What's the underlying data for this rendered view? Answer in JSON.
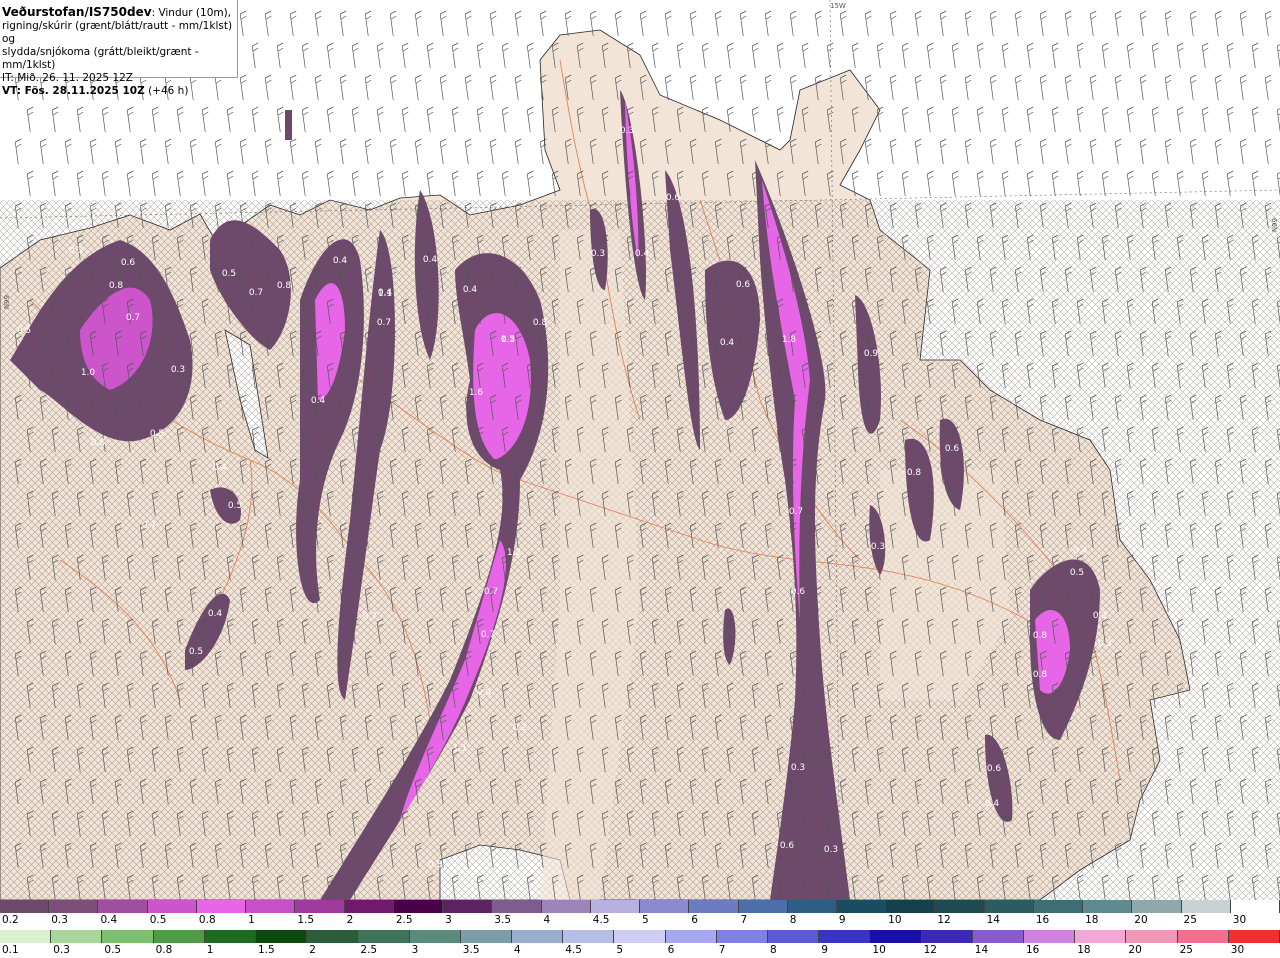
{
  "header": {
    "org": "Veðurstofan/IS750dev",
    "desc1": ": Vindur (10m),",
    "desc2": "rigning/skúrir (grænt/blátt/rautt - mm/1klst) og",
    "desc3": "slydda/snjókoma (grátt/bleikt/grænt - mm/1klst)",
    "it": "IT: Mið. 26. 11. 2025 12Z",
    "vt": "VT: Fös. 28.11.2025 10Z",
    "vt_offset": " (+46 h)"
  },
  "grid_labels": {
    "top": "15W",
    "right": "66N",
    "left": "66N"
  },
  "legend_snow": {
    "ticks": [
      "0.2",
      "0.3",
      "0.4",
      "0.5",
      "0.8",
      "1",
      "1.5",
      "2",
      "2.5",
      "3",
      "3.5",
      "4",
      "4.5",
      "5",
      "6",
      "7",
      "8",
      "9",
      "10",
      "12",
      "14",
      "16",
      "18",
      "20",
      "25",
      "30"
    ],
    "colors": [
      "#6d4a6b",
      "#7d4d7b",
      "#a24ea0",
      "#cc55cc",
      "#e766e7",
      "#c84fc8",
      "#a13a9e",
      "#6f1a6d",
      "#4a0048",
      "#5b2460",
      "#7e5c8e",
      "#9c86b7",
      "#b7b0e0",
      "#8a8ad0",
      "#6b7cc1",
      "#4d6fa9",
      "#2e5e86",
      "#1a4c62",
      "#17404e",
      "#1e4a52",
      "#2b5c62",
      "#3e6e74",
      "#5f8a90",
      "#8fa8ac",
      "#c8d2d4",
      "#ffffff"
    ]
  },
  "legend_rain": {
    "ticks": [
      "0.1",
      "0.3",
      "0.5",
      "0.8",
      "1",
      "1.5",
      "2",
      "2.5",
      "3",
      "3.5",
      "4",
      "4.5",
      "5",
      "6",
      "7",
      "8",
      "9",
      "10",
      "12",
      "14",
      "16",
      "18",
      "20",
      "25",
      "30"
    ],
    "colors": [
      "#d8f2d0",
      "#a7d89a",
      "#7cbf6e",
      "#4f9a44",
      "#1f6a1f",
      "#0a4a0a",
      "#2a5e3a",
      "#3e7458",
      "#5a8c7c",
      "#7a9ea8",
      "#98aed0",
      "#b6bee8",
      "#ccccf4",
      "#a8a8f0",
      "#7f80e2",
      "#5a5ad2",
      "#3a34c2",
      "#1a10a8",
      "#3a2ab4",
      "#8b5acc",
      "#cf82e0",
      "#f2a8d6",
      "#f098b8",
      "#f07090",
      "#f03030"
    ]
  },
  "map_labels": [
    {
      "v": "0.3"
    },
    {
      "v": "0.6"
    },
    {
      "v": "0.8"
    },
    {
      "v": "0.5"
    },
    {
      "v": "0.7"
    },
    {
      "v": "0.5"
    },
    {
      "v": "0.7"
    },
    {
      "v": "0.8"
    },
    {
      "v": "1.0"
    },
    {
      "v": "0.3"
    },
    {
      "v": "0.8"
    },
    {
      "v": "0.5"
    },
    {
      "v": "0.4"
    },
    {
      "v": "0.5"
    },
    {
      "v": "0.7"
    },
    {
      "v": "0.4"
    },
    {
      "v": "0.4"
    },
    {
      "v": "1.1"
    },
    {
      "v": "0.7"
    },
    {
      "v": "0.4"
    },
    {
      "v": "0.5"
    },
    {
      "v": "0.7"
    },
    {
      "v": "0.5"
    },
    {
      "v": "0.4"
    },
    {
      "v": "0.4"
    },
    {
      "v": "0.4"
    },
    {
      "v": "1.2"
    },
    {
      "v": "0.8"
    },
    {
      "v": "1.6"
    },
    {
      "v": "1.2"
    },
    {
      "v": "0.7"
    },
    {
      "v": "0.7"
    },
    {
      "v": "0.9"
    },
    {
      "v": "1.1"
    },
    {
      "v": "0.2"
    },
    {
      "v": "0.3"
    },
    {
      "v": "0.3"
    },
    {
      "v": "0.3"
    },
    {
      "v": "0.4"
    },
    {
      "v": "0.6"
    },
    {
      "v": "0.4"
    },
    {
      "v": "0.6"
    },
    {
      "v": "1.8"
    },
    {
      "v": "0.7"
    },
    {
      "v": "0.6"
    },
    {
      "v": "0.3"
    },
    {
      "v": "0.6"
    },
    {
      "v": "0.3"
    },
    {
      "v": "0.9"
    },
    {
      "v": "0.8"
    },
    {
      "v": "0.6"
    },
    {
      "v": "0.3"
    },
    {
      "v": "0.4"
    },
    {
      "v": "0.5"
    },
    {
      "v": "0.8"
    },
    {
      "v": "0.8"
    },
    {
      "v": "0.3"
    },
    {
      "v": "0.3"
    },
    {
      "v": "0.6"
    },
    {
      "v": "0.4"
    }
  ]
}
